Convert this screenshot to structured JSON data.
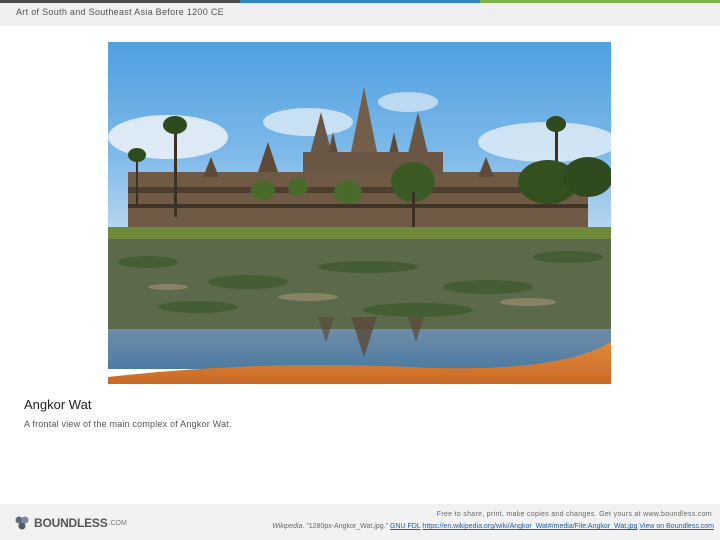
{
  "colors": {
    "accent_bar": [
      "#4a4a4a",
      "#2e86c1",
      "#7cb342"
    ],
    "header_bg": "#efefef",
    "footer_bg": "#f2f2f2",
    "link": "#1a5fa8"
  },
  "header": {
    "title": "Art of South and Southeast Asia Before 1200 CE"
  },
  "image": {
    "alt_icon": "photo-angkor-wat"
  },
  "caption": {
    "title": "Angkor Wat",
    "description": "A frontal view of the main complex of Angkor Wat."
  },
  "footer": {
    "logo_text": "BOUNDLESS",
    "logo_suffix": ".COM",
    "share_text": "Free to share, print, make copies and changes. Get yours at www.boundless.com",
    "source": "Wikipedia",
    "file_text": ". \"1280px-Angkor_Wat.jpg.\"",
    "license": "GNU FDL",
    "url": "https://en.wikipedia.org/wiki/Angkor_Wat#/media/File:Angkor_Wat.jpg",
    "view_link": "View on Boundless.com"
  }
}
